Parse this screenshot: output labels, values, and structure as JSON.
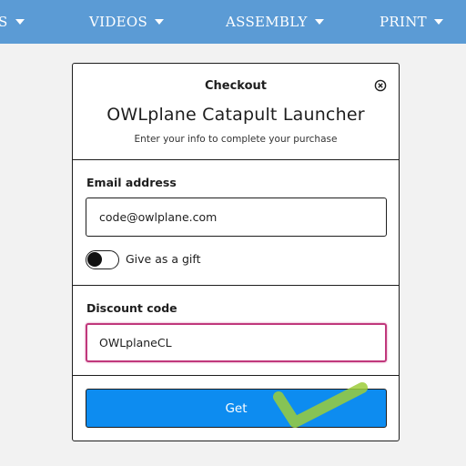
{
  "nav": {
    "items": [
      {
        "label": "S"
      },
      {
        "label": "VIDEOS"
      },
      {
        "label": "ASSEMBLY"
      },
      {
        "label": "PRINT"
      }
    ]
  },
  "checkout": {
    "heading": "Checkout",
    "product_title": "OWLplane Catapult Launcher",
    "subtitle": "Enter your info to complete your purchase",
    "email": {
      "label": "Email address",
      "value": "code@owlplane.com"
    },
    "gift": {
      "label": "Give as a gift",
      "checked": false
    },
    "discount": {
      "label": "Discount code",
      "value": "OWLplaneCL"
    },
    "submit_label": "Get"
  },
  "colors": {
    "nav_bg": "#5b9bd5",
    "button_bg": "#0d8cf0",
    "focus_border": "#c0387c",
    "checkmark": "#9ccc3a"
  },
  "icons": {
    "close": "close-icon",
    "caret": "chevron-down-icon",
    "overlay": "checkmark-icon"
  }
}
